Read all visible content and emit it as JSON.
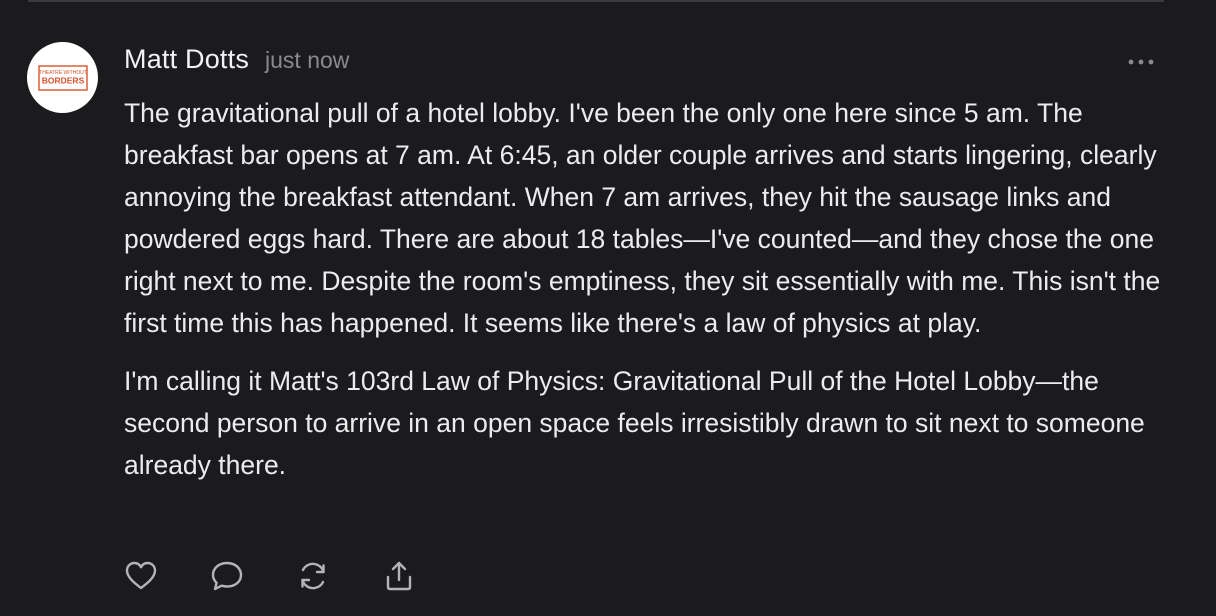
{
  "post": {
    "author": "Matt Dotts",
    "timestamp": "just now",
    "avatar": {
      "icon": "theatre-without-borders-logo",
      "logo_line1": "THEATRE WITHOUT",
      "logo_line2": "BORDERS",
      "brand_color": "#d9532b"
    },
    "paragraphs": [
      "The gravitational pull of a hotel lobby. I've been the only one here since 5 am. The breakfast bar opens at 7 am. At 6:45, an older couple arrives and starts lingering, clearly annoying the breakfast attendant. When 7 am arrives, they hit the sausage links and powdered eggs hard. There are about 18 tables—I've counted—and they chose the one right next to me. Despite the room's emptiness, they sit essentially with me. This isn't the first time this has happened. It seems like there's a law of physics at play.",
      "I'm calling it Matt's 103rd Law of Physics: Gravitational Pull of the Hotel Lobby—the second person to arrive in an open space feels irresistibly drawn to sit next to someone already there."
    ],
    "actions": [
      {
        "name": "like",
        "icon": "heart-icon"
      },
      {
        "name": "comment",
        "icon": "comment-icon"
      },
      {
        "name": "restack",
        "icon": "restack-icon"
      },
      {
        "name": "share",
        "icon": "share-icon"
      }
    ],
    "more_icon": "ellipsis-icon"
  },
  "colors": {
    "background": "#1b1b1d",
    "text": "#ececee",
    "muted": "#8a8a8f",
    "icon": "#b4b4b8"
  }
}
